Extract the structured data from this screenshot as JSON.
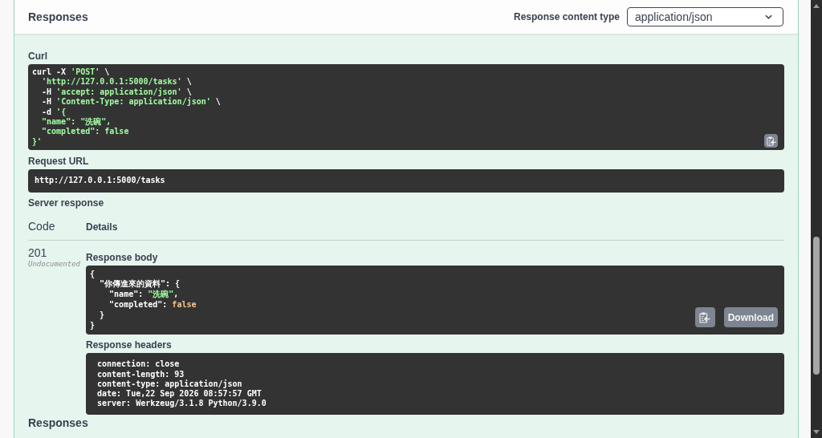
{
  "header": {
    "title": "Responses",
    "content_type_label": "Response content type",
    "content_type_value": "application/json"
  },
  "curl": {
    "label": "Curl",
    "lines": [
      [
        {
          "kind": "plain",
          "text": "curl -X "
        },
        {
          "kind": "string",
          "text": "'POST'"
        },
        {
          "kind": "plain",
          "text": " \\"
        }
      ],
      [
        {
          "kind": "string",
          "text": "  'http://127.0.0.1:5000/tasks'"
        },
        {
          "kind": "plain",
          "text": " \\"
        }
      ],
      [
        {
          "kind": "plain",
          "text": "  -H "
        },
        {
          "kind": "string",
          "text": "'accept: application/json'"
        },
        {
          "kind": "plain",
          "text": " \\"
        }
      ],
      [
        {
          "kind": "plain",
          "text": "  -H "
        },
        {
          "kind": "string",
          "text": "'Content-Type: application/json'"
        },
        {
          "kind": "plain",
          "text": " \\"
        }
      ],
      [
        {
          "kind": "plain",
          "text": "  -d "
        },
        {
          "kind": "string",
          "text": "'{"
        }
      ],
      [
        {
          "kind": "string",
          "text": "  \"name\": \"洗碗\","
        }
      ],
      [
        {
          "kind": "string",
          "text": "  \"completed\": false"
        }
      ],
      [
        {
          "kind": "string",
          "text": "}'"
        }
      ]
    ]
  },
  "request_url": {
    "label": "Request URL",
    "value": "http://127.0.0.1:5000/tasks"
  },
  "server_response": {
    "label": "Server response",
    "columns": [
      "Code",
      "Details"
    ],
    "rows": [
      {
        "code": "201",
        "note": "Undocumented",
        "body_label": "Response body",
        "body_lines": [
          [
            {
              "kind": "plain",
              "text": "{"
            }
          ],
          [
            {
              "kind": "plain",
              "text": "  \"你傳進來的資料\": {"
            }
          ],
          [
            {
              "kind": "plain",
              "text": "    \"name\": "
            },
            {
              "kind": "string",
              "text": "\"洗碗\""
            },
            {
              "kind": "plain",
              "text": ","
            }
          ],
          [
            {
              "kind": "plain",
              "text": "    \"completed\": "
            },
            {
              "kind": "literal",
              "text": "false"
            }
          ],
          [
            {
              "kind": "plain",
              "text": "  }"
            }
          ],
          [
            {
              "kind": "plain",
              "text": "}"
            }
          ]
        ],
        "download_label": "Download",
        "headers_label": "Response headers",
        "headers_lines": [
          "connection: close",
          "content-length: 93",
          "content-type: application/json",
          "date: Tue,22 Sep 2026 08:57:57 GMT",
          "server: Werkzeug/3.1.8 Python/3.9.0"
        ]
      }
    ]
  },
  "next_section": {
    "title": "Responses"
  }
}
